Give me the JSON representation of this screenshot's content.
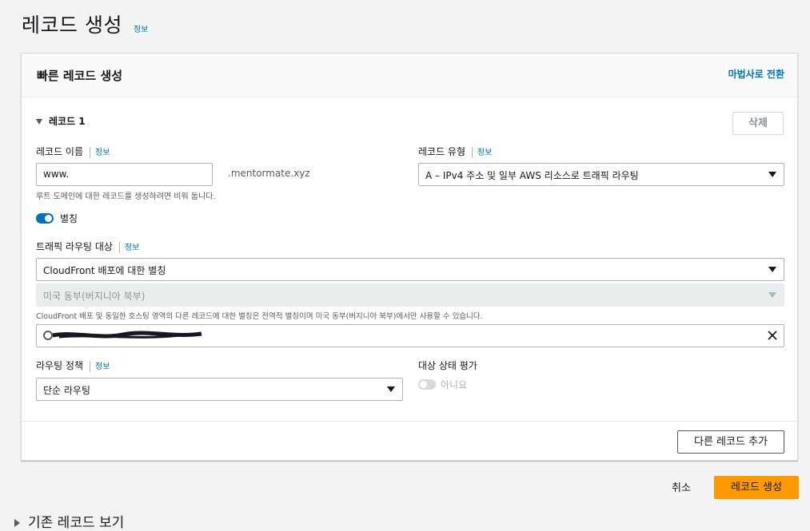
{
  "page": {
    "title": "레코드 생성",
    "info": "정보"
  },
  "card": {
    "title": "빠른 레코드 생성",
    "wizard_link": "마법사로 전환"
  },
  "record": {
    "heading": "레코드 1",
    "delete_label": "삭제",
    "name_label": "레코드 이름",
    "name_info": "정보",
    "name_value": "www.",
    "domain_suffix": ".mentormate.xyz",
    "name_hint": "루트 도메인에 대한 레코드를 생성하려면 비워 둡니다.",
    "type_label": "레코드 유형",
    "type_info": "정보",
    "type_value": "A – IPv4 주소 및 일부 AWS 리소스로 트래픽 라우팅",
    "alias_label": "별칭",
    "alias_on": true,
    "target_label": "트래픽 라우팅 대상",
    "target_info": "정보",
    "target_value": "CloudFront 배포에 대한 별칭",
    "region_value": "미국 동부(버지니아 북부)",
    "region_hint": "CloudFront 배포 및 동일한 호스팅 영역의 다른 레코드에 대한 별칭은 전역적 별칭이며 미국 동부(버지니아 북부)에서만 사용할 수 있습니다.",
    "routing_label": "라우팅 정책",
    "routing_info": "정보",
    "routing_value": "단순 라우팅",
    "health_label": "대상 상태 평가",
    "health_value": "아니요",
    "health_on": false
  },
  "footer": {
    "add_record": "다른 레코드 추가",
    "cancel": "취소",
    "create": "레코드 생성",
    "existing_records": "기존 레코드 보기"
  },
  "colors": {
    "primary": "#ff9900",
    "link": "#0073bb",
    "toggle_on": "#0073bb"
  }
}
